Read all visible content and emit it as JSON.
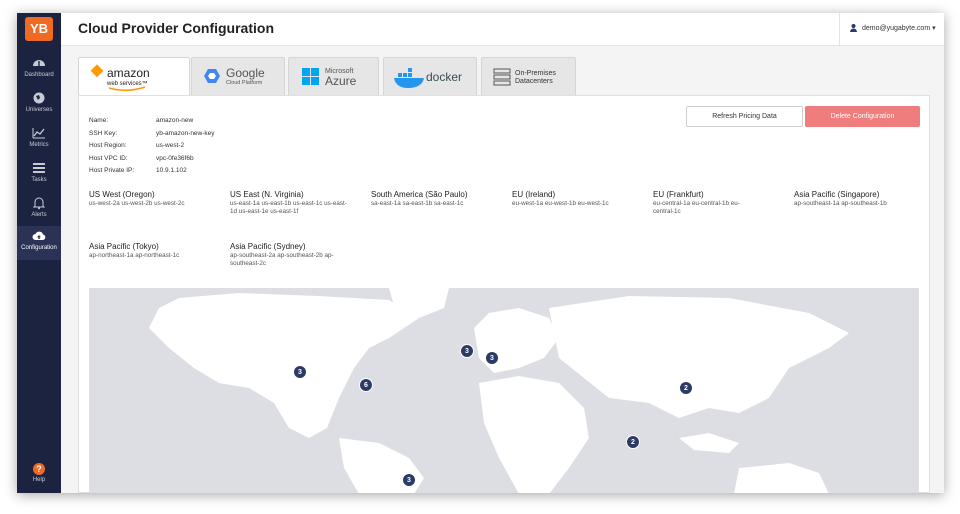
{
  "app": {
    "logo_text": "YB",
    "accent": "#f16a24",
    "sidebar_bg": "#1c2340"
  },
  "sidebar": {
    "items": [
      {
        "label": "Dashboard",
        "icon": "dashboard-icon"
      },
      {
        "label": "Universes",
        "icon": "globe-icon"
      },
      {
        "label": "Metrics",
        "icon": "line-chart-icon"
      },
      {
        "label": "Tasks",
        "icon": "list-icon"
      },
      {
        "label": "Alerts",
        "icon": "bell-icon"
      },
      {
        "label": "Configuration",
        "icon": "cloud-upload-icon",
        "active": true
      }
    ],
    "help_label": "Help",
    "help_glyph": "?"
  },
  "header": {
    "title": "Cloud Provider Configuration",
    "user": "demo@yugabyte.com",
    "caret": "▾"
  },
  "tabs": [
    {
      "id": "aws",
      "line1": "amazon",
      "line2": "web services™",
      "active": true
    },
    {
      "id": "gcp",
      "line1": "Google",
      "line2": "Cloud Platform"
    },
    {
      "id": "azure",
      "line1": "Microsoft",
      "line2": "Azure"
    },
    {
      "id": "docker",
      "line1": "docker"
    },
    {
      "id": "onprem",
      "line1": "On-Premises",
      "line2": "Datacenters"
    }
  ],
  "actions": {
    "refresh_label": "Refresh Pricing Data",
    "delete_label": "Delete Configuration"
  },
  "provider_info": [
    {
      "key": "Name:",
      "value": "amazon-new"
    },
    {
      "key": "SSH Key:",
      "value": "yb-amazon-new-key"
    },
    {
      "key": "Host Region:",
      "value": "us-west-2"
    },
    {
      "key": "Host VPC ID:",
      "value": "vpc-0fe36f6b"
    },
    {
      "key": "Host Private IP:",
      "value": "10.9.1.102"
    }
  ],
  "regions": [
    {
      "name": "US West (Oregon)",
      "zones": "us-west-2a  us-west-2b  us-west-2c"
    },
    {
      "name": "US East (N. Virginia)",
      "zones": "us-east-1a  us-east-1b  us-east-1c  us-east-1d  us-east-1e  us-east-1f"
    },
    {
      "name": "South America (São Paulo)",
      "zones": "sa-east-1a  sa-east-1b  sa-east-1c"
    },
    {
      "name": "EU (Ireland)",
      "zones": "eu-west-1a  eu-west-1b  eu-west-1c"
    },
    {
      "name": "EU (Frankfurt)",
      "zones": "eu-central-1a  eu-central-1b  eu-central-1c"
    },
    {
      "name": "Asia Pacific (Singapore)",
      "zones": "ap-southeast-1a  ap-southeast-1b"
    },
    {
      "name": "Asia Pacific (Tokyo)",
      "zones": "ap-northeast-1a  ap-northeast-1c"
    },
    {
      "name": "Asia Pacific (Sydney)",
      "zones": "ap-southeast-2a  ap-southeast-2b  ap-southeast-2c"
    }
  ],
  "map": {
    "markers": [
      {
        "label": "3"
      },
      {
        "label": "6"
      },
      {
        "label": "3"
      },
      {
        "label": "3"
      },
      {
        "label": "2"
      },
      {
        "label": "2"
      },
      {
        "label": "3"
      }
    ]
  }
}
